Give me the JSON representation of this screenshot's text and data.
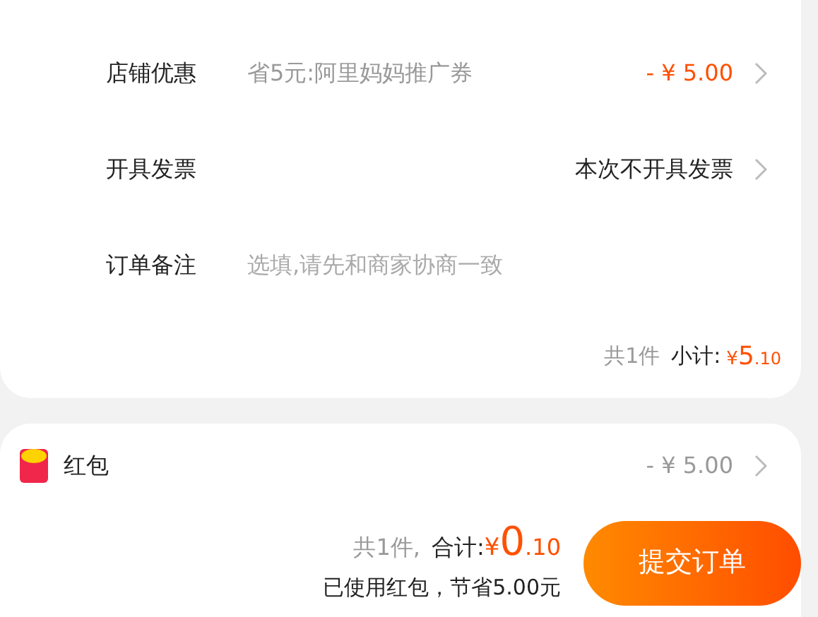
{
  "order_rows": [
    {
      "kind": "value",
      "label": "店铺优惠",
      "note": "省5元:阿里妈妈推广券",
      "value": "- ¥ 5.00",
      "highlight": true
    },
    {
      "kind": "value",
      "label": "开具发票",
      "value": "本次不开具发票",
      "highlight": false
    },
    {
      "kind": "input",
      "label": "订单备注",
      "placeholder": "选填,请先和商家协商一致"
    }
  ],
  "subtotal": {
    "count": "共1件",
    "label": "小计:",
    "currency": "¥",
    "integer": "5",
    "decimal": ".10"
  },
  "red_packet": {
    "label": "红包",
    "value": "- ¥ 5.00"
  },
  "footer": {
    "count": "共1件,",
    "label": "合计:",
    "currency": "¥",
    "integer": "0",
    "decimal": ".10",
    "savings": "已使用红包，节省5.00元",
    "submit": "提交订单"
  }
}
